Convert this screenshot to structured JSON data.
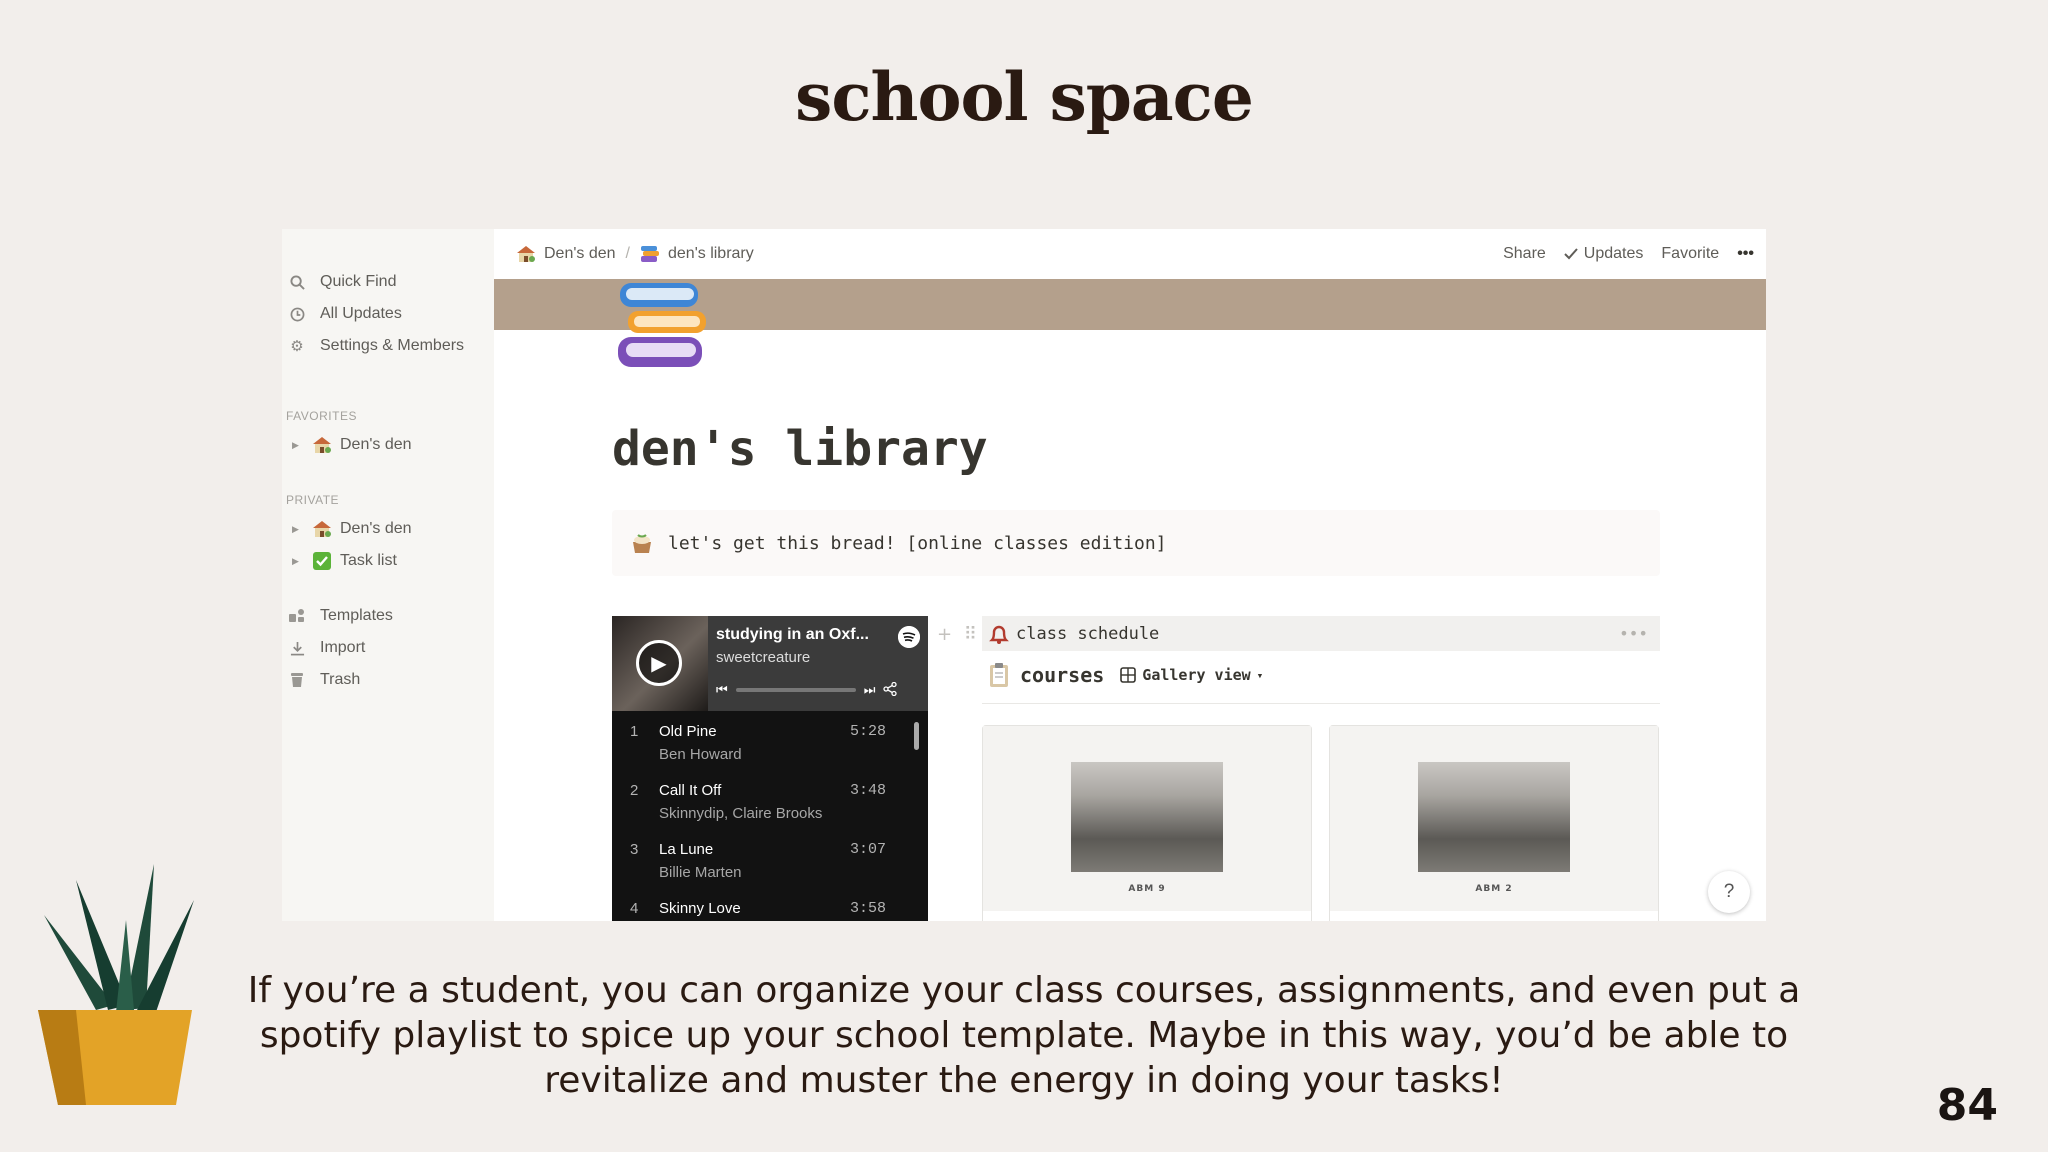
{
  "slide": {
    "title": "school space",
    "caption": "If you’re a student, you can organize your class courses, assignments, and even put a spotify playlist to spice up your school template. Maybe in this way, you’d be able to revitalize and muster the energy in doing your tasks!",
    "page_number": "84"
  },
  "sidebar": {
    "top_items": [
      {
        "label": "Quick Find",
        "icon": "search-icon"
      },
      {
        "label": "All Updates",
        "icon": "clock-icon"
      },
      {
        "label": "Settings & Members",
        "icon": "gear-icon"
      }
    ],
    "favorites_header": "FAVORITES",
    "favorites": [
      {
        "label": "Den's den",
        "icon": "house-icon"
      }
    ],
    "private_header": "PRIVATE",
    "private": [
      {
        "label": "Den's den",
        "icon": "house-icon"
      },
      {
        "label": "Task list",
        "icon": "checkbox-icon"
      }
    ],
    "bottom_items": [
      {
        "label": "Templates",
        "icon": "templates-icon"
      },
      {
        "label": "Import",
        "icon": "download-icon"
      },
      {
        "label": "Trash",
        "icon": "trash-icon"
      }
    ]
  },
  "topbar": {
    "breadcrumb": [
      "Den's den",
      "den's library"
    ],
    "share": "Share",
    "updates": "Updates",
    "favorite": "Favorite",
    "more": "•••"
  },
  "page": {
    "title": "den's library",
    "callout": "let's get this bread! [online classes edition]",
    "banner_color": "#b4a08c"
  },
  "spotify": {
    "title": "studying in an Oxf...",
    "artist": "sweetcreature",
    "tracks": [
      {
        "n": "1",
        "title": "Old Pine",
        "artist": "Ben Howard",
        "duration": "5:28"
      },
      {
        "n": "2",
        "title": "Call It Off",
        "artist": "Skinnydip, Claire Brooks",
        "duration": "3:48"
      },
      {
        "n": "3",
        "title": "La Lune",
        "artist": "Billie Marten",
        "duration": "3:07"
      },
      {
        "n": "4",
        "title": "Skinny Love",
        "artist": "",
        "duration": "3:58"
      }
    ]
  },
  "database": {
    "heading": "class schedule",
    "more": "•••",
    "name": "courses",
    "view": "Gallery view",
    "cards": [
      {
        "caption": "ABM 9"
      },
      {
        "caption": "ABM 2"
      }
    ]
  },
  "help": "?"
}
